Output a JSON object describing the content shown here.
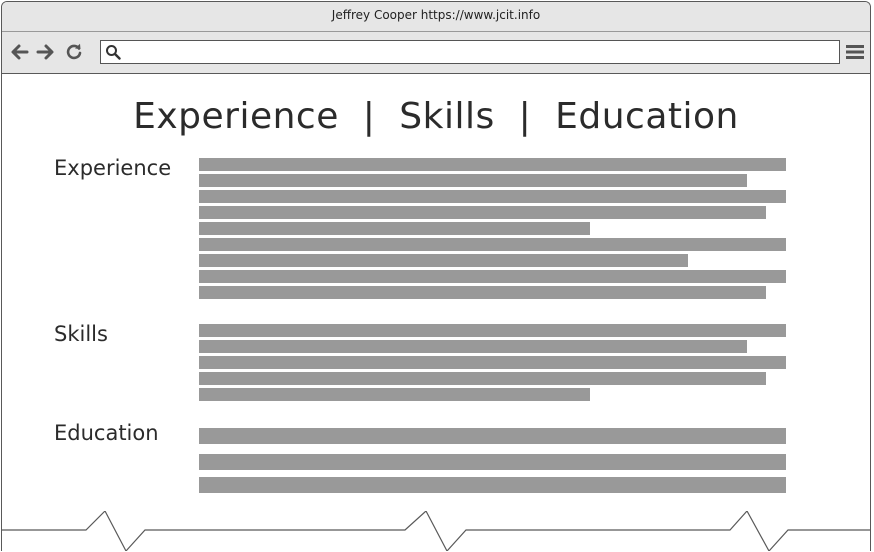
{
  "window": {
    "title": "Jeffrey Cooper https://www.jcit.info"
  },
  "toolbar": {
    "back_icon": "arrow-left-icon",
    "forward_icon": "arrow-right-icon",
    "reload_icon": "reload-icon",
    "search_icon": "search-icon",
    "menu_icon": "hamburger-menu-icon",
    "url_value": "",
    "url_placeholder": ""
  },
  "page": {
    "heading": "Experience  |  Skills  |  Education",
    "sections": [
      {
        "label": "Experience"
      },
      {
        "label": "Skills"
      },
      {
        "label": "Education"
      }
    ]
  },
  "colors": {
    "placeholder_bar": "#999999",
    "chrome_background": "#e6e6e6",
    "text": "#2b2b2b"
  }
}
